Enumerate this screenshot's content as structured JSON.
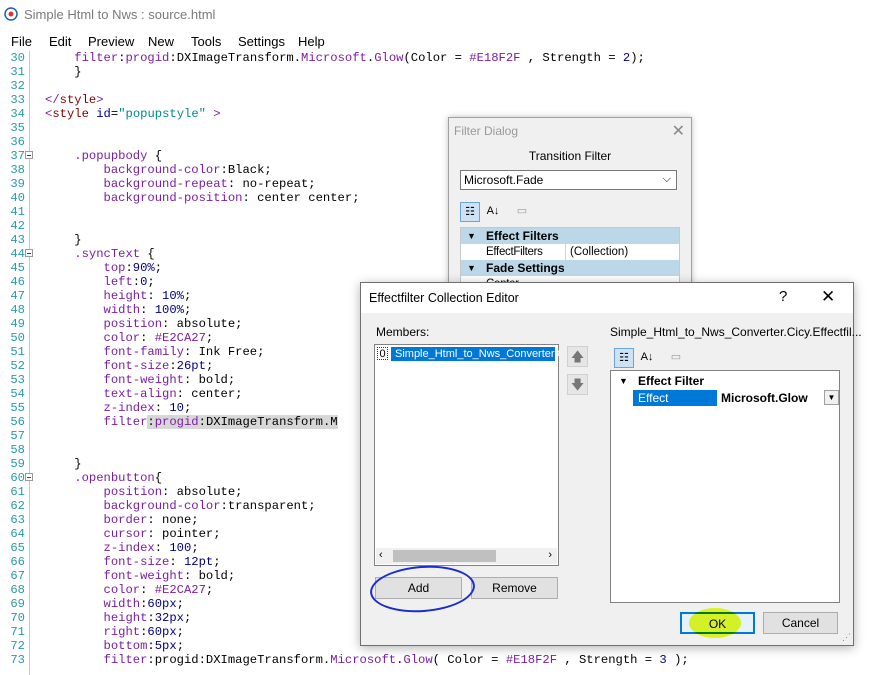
{
  "window": {
    "title": "Simple Html to Nws : source.html"
  },
  "menu": [
    "File",
    "Edit",
    "Preview",
    "New",
    "Tools",
    "Settings",
    "Help"
  ],
  "code_lines": [
    {
      "n": "30",
      "fold": false,
      "tokens": [
        [
          "    ",
          ""
        ],
        [
          "filter",
          ""
        ],
        [
          ":",
          "t-black"
        ],
        [
          "progid",
          "t-purple"
        ],
        [
          ":DXImageTransform.",
          "t-black"
        ],
        [
          "Microsoft",
          "t-purple"
        ],
        [
          ".",
          "t-black"
        ],
        [
          "Glow",
          "t-purple"
        ],
        [
          "(Color = ",
          "t-black"
        ],
        [
          "#E18F2F",
          "t-purple"
        ],
        [
          " , Strength = ",
          "t-black"
        ],
        [
          "2",
          "t-navy"
        ],
        [
          ");",
          "t-black"
        ]
      ]
    },
    {
      "n": "31",
      "fold": false,
      "tokens": [
        [
          "    }",
          "t-black"
        ]
      ]
    },
    {
      "n": "32",
      "fold": false,
      "tokens": []
    },
    {
      "n": "33",
      "fold": false,
      "tokens": [
        [
          "</",
          "t-purple"
        ],
        [
          "style",
          "t-maroon"
        ],
        [
          ">",
          "t-purple"
        ]
      ]
    },
    {
      "n": "34",
      "fold": false,
      "tokens": [
        [
          "<",
          "t-purple"
        ],
        [
          "style ",
          "t-maroon"
        ],
        [
          "id",
          "t-navy"
        ],
        [
          "=",
          "t-black"
        ],
        [
          "\"popupstyle\"",
          "t-green"
        ],
        [
          " >",
          "t-purple"
        ]
      ]
    },
    {
      "n": "35",
      "fold": false,
      "tokens": []
    },
    {
      "n": "36",
      "fold": false,
      "tokens": []
    },
    {
      "n": "37",
      "fold": true,
      "tokens": [
        [
          "    .popupbody",
          "t-purple"
        ],
        [
          " {",
          "t-black"
        ]
      ]
    },
    {
      "n": "38",
      "fold": false,
      "tokens": [
        [
          "        background-color",
          "t-purple"
        ],
        [
          ":Black;",
          "t-black"
        ]
      ]
    },
    {
      "n": "39",
      "fold": false,
      "tokens": [
        [
          "        background-repeat",
          "t-purple"
        ],
        [
          ": no-repeat;",
          "t-black"
        ]
      ]
    },
    {
      "n": "40",
      "fold": false,
      "tokens": [
        [
          "        background-position",
          "t-purple"
        ],
        [
          ": center center;",
          "t-black"
        ]
      ]
    },
    {
      "n": "41",
      "fold": false,
      "tokens": []
    },
    {
      "n": "42",
      "fold": false,
      "tokens": []
    },
    {
      "n": "43",
      "fold": false,
      "tokens": [
        [
          "    }",
          "t-black"
        ]
      ]
    },
    {
      "n": "44",
      "fold": true,
      "tokens": [
        [
          "    .syncText",
          "t-purple"
        ],
        [
          " {",
          "t-black"
        ]
      ]
    },
    {
      "n": "45",
      "fold": false,
      "tokens": [
        [
          "        top",
          "t-purple"
        ],
        [
          ":",
          "t-black"
        ],
        [
          "90%",
          "t-navy"
        ],
        [
          ";",
          "t-black"
        ]
      ]
    },
    {
      "n": "46",
      "fold": false,
      "tokens": [
        [
          "        left",
          "t-purple"
        ],
        [
          ":",
          "t-black"
        ],
        [
          "0",
          "t-navy"
        ],
        [
          ";",
          "t-black"
        ]
      ]
    },
    {
      "n": "47",
      "fold": false,
      "tokens": [
        [
          "        height",
          "t-purple"
        ],
        [
          ": ",
          "t-black"
        ],
        [
          "10%",
          "t-navy"
        ],
        [
          ";",
          "t-black"
        ]
      ]
    },
    {
      "n": "48",
      "fold": false,
      "tokens": [
        [
          "        width",
          "t-purple"
        ],
        [
          ": ",
          "t-black"
        ],
        [
          "100%",
          "t-navy"
        ],
        [
          ";",
          "t-black"
        ]
      ]
    },
    {
      "n": "49",
      "fold": false,
      "tokens": [
        [
          "        position",
          "t-purple"
        ],
        [
          ": absolute;",
          "t-black"
        ]
      ]
    },
    {
      "n": "50",
      "fold": false,
      "tokens": [
        [
          "        color",
          "t-purple"
        ],
        [
          ": ",
          "t-black"
        ],
        [
          "#E2CA27",
          "t-purple"
        ],
        [
          ";",
          "t-black"
        ]
      ]
    },
    {
      "n": "51",
      "fold": false,
      "tokens": [
        [
          "        font-family",
          "t-purple"
        ],
        [
          ": Ink Free;",
          "t-black"
        ]
      ]
    },
    {
      "n": "52",
      "fold": false,
      "tokens": [
        [
          "        font-size",
          "t-purple"
        ],
        [
          ":",
          "t-black"
        ],
        [
          "26pt",
          "t-navy"
        ],
        [
          ";",
          "t-black"
        ]
      ]
    },
    {
      "n": "53",
      "fold": false,
      "tokens": [
        [
          "        font-weight",
          "t-purple"
        ],
        [
          ": bold;",
          "t-black"
        ]
      ]
    },
    {
      "n": "54",
      "fold": false,
      "tokens": [
        [
          "        text-align",
          "t-purple"
        ],
        [
          ": center;",
          "t-black"
        ]
      ]
    },
    {
      "n": "55",
      "fold": false,
      "tokens": [
        [
          "        z-index",
          "t-purple"
        ],
        [
          ": ",
          "t-black"
        ],
        [
          "10",
          "t-navy"
        ],
        [
          ";",
          "t-black"
        ]
      ]
    },
    {
      "n": "56",
      "fold": false,
      "tokens": [
        [
          "        filter",
          "t-purple"
        ],
        [
          ":",
          "t-black hl"
        ],
        [
          "progid",
          "t-purple hl"
        ],
        [
          ":DXImageTransform.M",
          "t-black hl"
        ]
      ]
    },
    {
      "n": "57",
      "fold": false,
      "tokens": []
    },
    {
      "n": "58",
      "fold": false,
      "tokens": []
    },
    {
      "n": "59",
      "fold": false,
      "tokens": [
        [
          "    }",
          "t-black"
        ]
      ]
    },
    {
      "n": "60",
      "fold": true,
      "tokens": [
        [
          "    .openbutton",
          "t-purple"
        ],
        [
          "{",
          "t-black"
        ]
      ]
    },
    {
      "n": "61",
      "fold": false,
      "tokens": [
        [
          "        position",
          "t-purple"
        ],
        [
          ": absolute;",
          "t-black"
        ]
      ]
    },
    {
      "n": "62",
      "fold": false,
      "tokens": [
        [
          "        background-color",
          "t-purple"
        ],
        [
          ":transparent;",
          "t-black"
        ]
      ]
    },
    {
      "n": "63",
      "fold": false,
      "tokens": [
        [
          "        border",
          "t-purple"
        ],
        [
          ": none;",
          "t-black"
        ]
      ]
    },
    {
      "n": "64",
      "fold": false,
      "tokens": [
        [
          "        cursor",
          "t-purple"
        ],
        [
          ": pointer;",
          "t-black"
        ]
      ]
    },
    {
      "n": "65",
      "fold": false,
      "tokens": [
        [
          "        z-index",
          "t-purple"
        ],
        [
          ": ",
          "t-black"
        ],
        [
          "100",
          "t-navy"
        ],
        [
          ";",
          "t-black"
        ]
      ]
    },
    {
      "n": "66",
      "fold": false,
      "tokens": [
        [
          "        font-size",
          "t-purple"
        ],
        [
          ": ",
          "t-black"
        ],
        [
          "12pt",
          "t-navy"
        ],
        [
          ";",
          "t-black"
        ]
      ]
    },
    {
      "n": "67",
      "fold": false,
      "tokens": [
        [
          "        font-weight",
          "t-purple"
        ],
        [
          ": bold;",
          "t-black"
        ]
      ]
    },
    {
      "n": "68",
      "fold": false,
      "tokens": [
        [
          "        color",
          "t-purple"
        ],
        [
          ": ",
          "t-black"
        ],
        [
          "#E2CA27",
          "t-purple"
        ],
        [
          ";",
          "t-black"
        ]
      ]
    },
    {
      "n": "69",
      "fold": false,
      "tokens": [
        [
          "        width",
          "t-purple"
        ],
        [
          ":",
          "t-black"
        ],
        [
          "60px",
          "t-navy"
        ],
        [
          ";",
          "t-black"
        ]
      ]
    },
    {
      "n": "70",
      "fold": false,
      "tokens": [
        [
          "        height",
          "t-purple"
        ],
        [
          ":",
          "t-black"
        ],
        [
          "32px",
          "t-navy"
        ],
        [
          ";",
          "t-black"
        ]
      ]
    },
    {
      "n": "71",
      "fold": false,
      "tokens": [
        [
          "        right",
          "t-purple"
        ],
        [
          ":",
          "t-black"
        ],
        [
          "60px",
          "t-navy"
        ],
        [
          ";",
          "t-black"
        ]
      ]
    },
    {
      "n": "72",
      "fold": false,
      "tokens": [
        [
          "        bottom",
          "t-purple"
        ],
        [
          ":",
          "t-black"
        ],
        [
          "5px",
          "t-navy"
        ],
        [
          ";",
          "t-black"
        ]
      ]
    },
    {
      "n": "73",
      "fold": false,
      "tokens": [
        [
          "        filter",
          "t-purple"
        ],
        [
          ":progid:DXImageTransform.",
          "t-black"
        ],
        [
          "Microsoft",
          "t-purple"
        ],
        [
          ".",
          "t-black"
        ],
        [
          "Glow",
          "t-purple"
        ],
        [
          "( Color = ",
          "t-black"
        ],
        [
          "#E18F2F",
          "t-purple"
        ],
        [
          " , Strength = ",
          "t-black"
        ],
        [
          "3",
          "t-navy"
        ],
        [
          " );",
          "t-black"
        ]
      ]
    }
  ],
  "filter_dialog": {
    "title": "Filter Dialog",
    "label": "Transition Filter",
    "selected_filter": "Microsoft.Fade",
    "categories": [
      {
        "label": "Effect Filters",
        "props": [
          {
            "name": "EffectFilters",
            "value": "(Collection)"
          }
        ]
      },
      {
        "label": "Fade Settings",
        "props": [
          {
            "name": "Center",
            "value": ""
          }
        ]
      }
    ]
  },
  "collection_editor": {
    "title": "Effectfilter Collection Editor",
    "help": "?",
    "members_label": "Members:",
    "members": [
      {
        "index": "0",
        "name": "Simple_Html_to_Nws_Converter.Cicy.Effectfil"
      }
    ],
    "properties_label": "Simple_Html_to_Nws_Converter.Cicy.Effectfil...",
    "category": "Effect Filter",
    "property_name": "Effect",
    "property_value": "Microsoft.Glow",
    "add_label": "Add",
    "remove_label": "Remove",
    "ok_label": "OK",
    "cancel_label": "Cancel"
  },
  "colors": {
    "accent": "#0078d7",
    "line_numbers": "#2a9aa6",
    "annotation_circle": "#1a2ccf",
    "annotation_highlight": "#e8ff00"
  }
}
